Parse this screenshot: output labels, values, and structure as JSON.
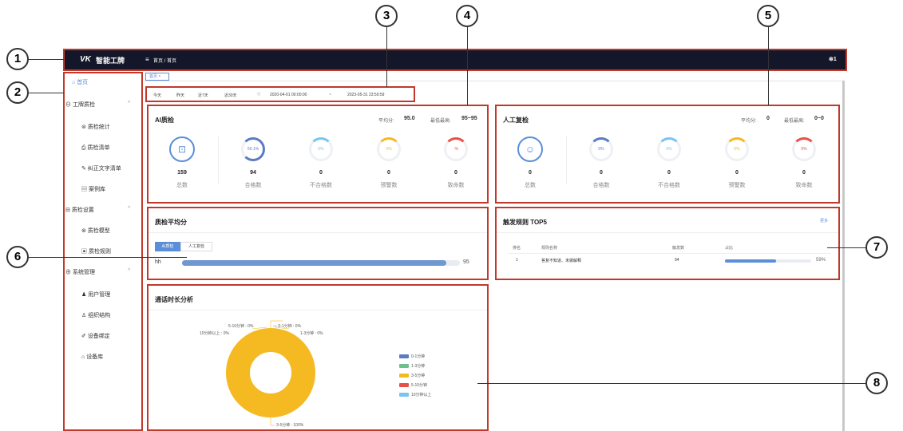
{
  "app": {
    "logo_text": "VK",
    "title": "智能工牌",
    "breadcrumb": "首页 / 首页",
    "user_badge": "⊛1"
  },
  "tab": {
    "label": "首页"
  },
  "sidebar": {
    "home": "首页",
    "groups": [
      {
        "label": "工牌质检",
        "items": [
          "质检统计",
          "质检清单",
          "纠正文字清单",
          "案例库"
        ]
      },
      {
        "label": "质检设置",
        "items": [
          "质检模型",
          "质检规则"
        ]
      },
      {
        "label": "系统管理",
        "items": [
          "用户管理",
          "组织结构",
          "设备绑定",
          "设备库"
        ]
      }
    ]
  },
  "date_filter": {
    "buttons": [
      "今天",
      "昨天",
      "近7天",
      "近30天"
    ],
    "start": "2020-04-01 00:00:00",
    "sep": "~",
    "end": "2023-05-31 23:59:59"
  },
  "ai_check": {
    "title": "AI质检",
    "avg_label": "平均分:",
    "avg_value": "95.0",
    "range_label": "最低最高:",
    "range_value": "95~95",
    "stats": [
      {
        "ring": "",
        "value": "159",
        "label": "总数"
      },
      {
        "ring": "59.1%",
        "value": "94",
        "label": "合格数"
      },
      {
        "ring": "0%",
        "value": "0",
        "label": "不合格数"
      },
      {
        "ring": "0%",
        "value": "0",
        "label": "预警数"
      },
      {
        "ring": "-%",
        "value": "0",
        "label": "致命数"
      }
    ]
  },
  "manual_check": {
    "title": "人工复检",
    "avg_label": "平均分:",
    "avg_value": "0",
    "range_label": "最低最高:",
    "range_value": "0~0",
    "stats": [
      {
        "ring": "",
        "value": "0",
        "label": "总数"
      },
      {
        "ring": "0%",
        "value": "0",
        "label": "合格数"
      },
      {
        "ring": "0%",
        "value": "0",
        "label": "不合格数"
      },
      {
        "ring": "0%",
        "value": "0",
        "label": "预警数"
      },
      {
        "ring": "0%",
        "value": "0",
        "label": "致命数"
      }
    ]
  },
  "avg_score": {
    "title": "质检平均分",
    "tabs": [
      "AI质检",
      "人工复检"
    ],
    "row_name": "hh",
    "row_value": "95",
    "row_fraction": 0.95
  },
  "top5": {
    "title": "触发规则 TOP5",
    "more": "更多",
    "headers": [
      "排名",
      "规则名称",
      "触发数",
      "占比"
    ],
    "rows": [
      {
        "rank": "1",
        "name": "答复不知道、未做解释",
        "count": "94",
        "pct": "59%",
        "fraction": 0.59
      }
    ]
  },
  "duration": {
    "title": "通话时长分析",
    "labels": [
      "5-10分钟 : 0%",
      "— 0-1分钟 : 0%",
      "10分钟以上 : 0%",
      "1-3分钟 : 0%",
      "3-5分钟 : 100%"
    ],
    "legend": [
      "0-1分钟",
      "1-3分钟",
      "3-5分钟",
      "5-10分钟",
      "10分钟以上"
    ],
    "legend_colors": [
      "#5b7bc4",
      "#6cc18b",
      "#f5b921",
      "#e8504a",
      "#79c4f0"
    ]
  },
  "callouts": [
    "1",
    "2",
    "3",
    "4",
    "5",
    "6",
    "7",
    "8"
  ],
  "chart_data": {
    "type": "pie",
    "title": "通话时长分析",
    "categories": [
      "0-1分钟",
      "1-3分钟",
      "3-5分钟",
      "5-10分钟",
      "10分钟以上"
    ],
    "values": [
      0,
      0,
      100,
      0,
      0
    ],
    "legend": "right"
  }
}
